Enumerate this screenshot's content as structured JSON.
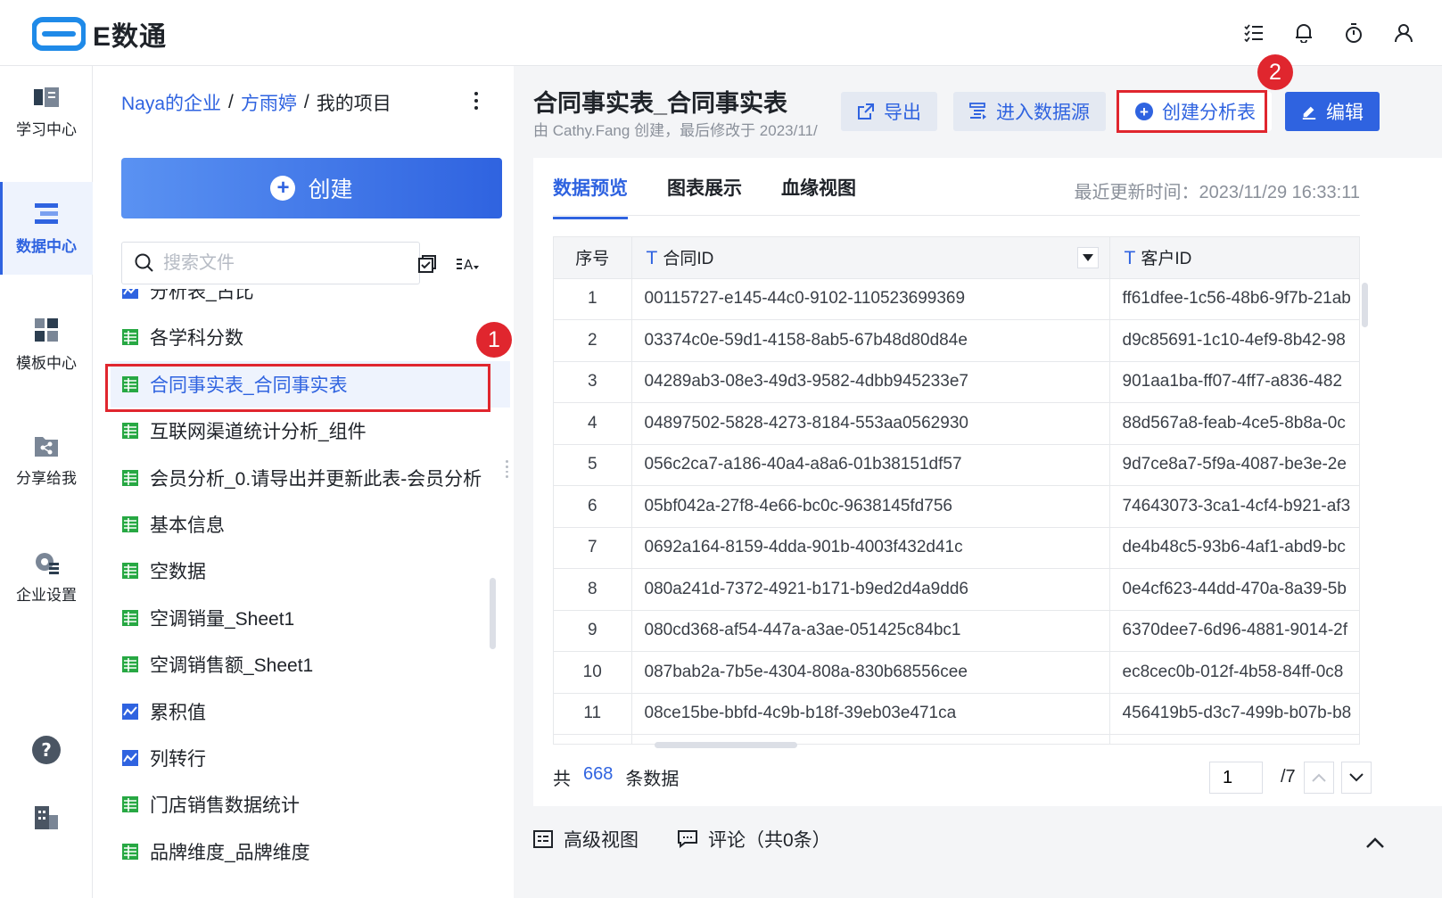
{
  "app": {
    "name": "E数通",
    "brand_color": "#2f63e0",
    "alert_color": "#e0262e"
  },
  "header_icons": [
    "task-list-icon",
    "bell-icon",
    "timer-icon",
    "user-icon"
  ],
  "rail": {
    "items": [
      {
        "label": "学习中心",
        "icon": "book-icon"
      },
      {
        "label": "数据中心",
        "icon": "database-icon",
        "active": true
      },
      {
        "label": "模板中心",
        "icon": "template-icon"
      },
      {
        "label": "分享给我",
        "icon": "share-icon"
      },
      {
        "label": "企业设置",
        "icon": "gear-icon"
      }
    ],
    "bottom": [
      "help-icon",
      "building-icon"
    ]
  },
  "panel": {
    "breadcrumb": [
      "Naya的企业",
      "方雨婷",
      "我的项目"
    ],
    "create_label": "创建",
    "search_placeholder": "搜索文件",
    "files": [
      {
        "name": "分析表_占比",
        "type": "chart"
      },
      {
        "name": "各学科分数",
        "type": "table"
      },
      {
        "name": "合同事实表_合同事实表",
        "type": "table",
        "selected": true
      },
      {
        "name": "互联网渠道统计分析_组件",
        "type": "table"
      },
      {
        "name": "会员分析_0.请导出并更新此表-会员分析",
        "type": "table"
      },
      {
        "name": "基本信息",
        "type": "table"
      },
      {
        "name": "空数据",
        "type": "table"
      },
      {
        "name": "空调销量_Sheet1",
        "type": "table"
      },
      {
        "name": "空调销售额_Sheet1",
        "type": "table"
      },
      {
        "name": "累积值",
        "type": "chart"
      },
      {
        "name": "列转行",
        "type": "chart"
      },
      {
        "name": "门店销售数据统计",
        "type": "table"
      },
      {
        "name": "品牌维度_品牌维度",
        "type": "table"
      }
    ]
  },
  "steps": {
    "one": "1",
    "two": "2"
  },
  "main": {
    "title": "合同事实表_合同事实表",
    "subtitle": "由 Cathy.Fang 创建，最后修改于 2023/11/",
    "actions": {
      "export": "导出",
      "enter_source": "进入数据源",
      "create_analysis": "创建分析表",
      "edit": "编辑"
    },
    "tabs": [
      "数据预览",
      "图表展示",
      "血缘视图"
    ],
    "updated": "最近更新时间：2023/11/29 16:33:11",
    "table": {
      "columns": [
        "序号",
        "合同ID",
        "客户ID"
      ],
      "rows": [
        [
          "1",
          "00115727-e145-44c0-9102-110523699369",
          "ff61dfee-1c56-48b6-9f7b-21ab"
        ],
        [
          "2",
          "03374c0e-59d1-4158-8ab5-67b48d80d84e",
          "d9c85691-1c10-4ef9-8b42-98"
        ],
        [
          "3",
          "04289ab3-08e3-49d3-9582-4dbb945233e7",
          "901aa1ba-ff07-4ff7-a836-482"
        ],
        [
          "4",
          "04897502-5828-4273-8184-553aa0562930",
          "88d567a8-feab-4ce5-8b8a-0c"
        ],
        [
          "5",
          "056c2ca7-a186-40a4-a8a6-01b38151df57",
          "9d7ce8a7-5f9a-4087-be3e-2e"
        ],
        [
          "6",
          "05bf042a-27f8-4e66-bc0c-9638145fd756",
          "74643073-3ca1-4cf4-b921-af3"
        ],
        [
          "7",
          "0692a164-8159-4dda-901b-4003f432d41c",
          "de4b48c5-93b6-4af1-abd9-bc"
        ],
        [
          "8",
          "080a241d-7372-4921-b171-b9ed2d4a9dd6",
          "0e4cf623-44dd-470a-8a39-5b"
        ],
        [
          "9",
          "080cd368-af54-447a-a3ae-051425c84bc1",
          "6370dee7-6d96-4881-9014-2f"
        ],
        [
          "10",
          "087bab2a-7b5e-4304-808a-830b68556cee",
          "ec8cec0b-012f-4b58-84ff-0c8"
        ],
        [
          "11",
          "08ce15be-bbfd-4c9b-b18f-39eb03e471ca",
          "456419b5-d3c7-499b-b07b-b8"
        ]
      ]
    },
    "footer": {
      "prefix": "共",
      "count": "668",
      "suffix": "条数据",
      "page": "1",
      "pages": "/7"
    },
    "bottom": {
      "advanced": "高级视图",
      "comments": "评论（共0条）"
    }
  }
}
